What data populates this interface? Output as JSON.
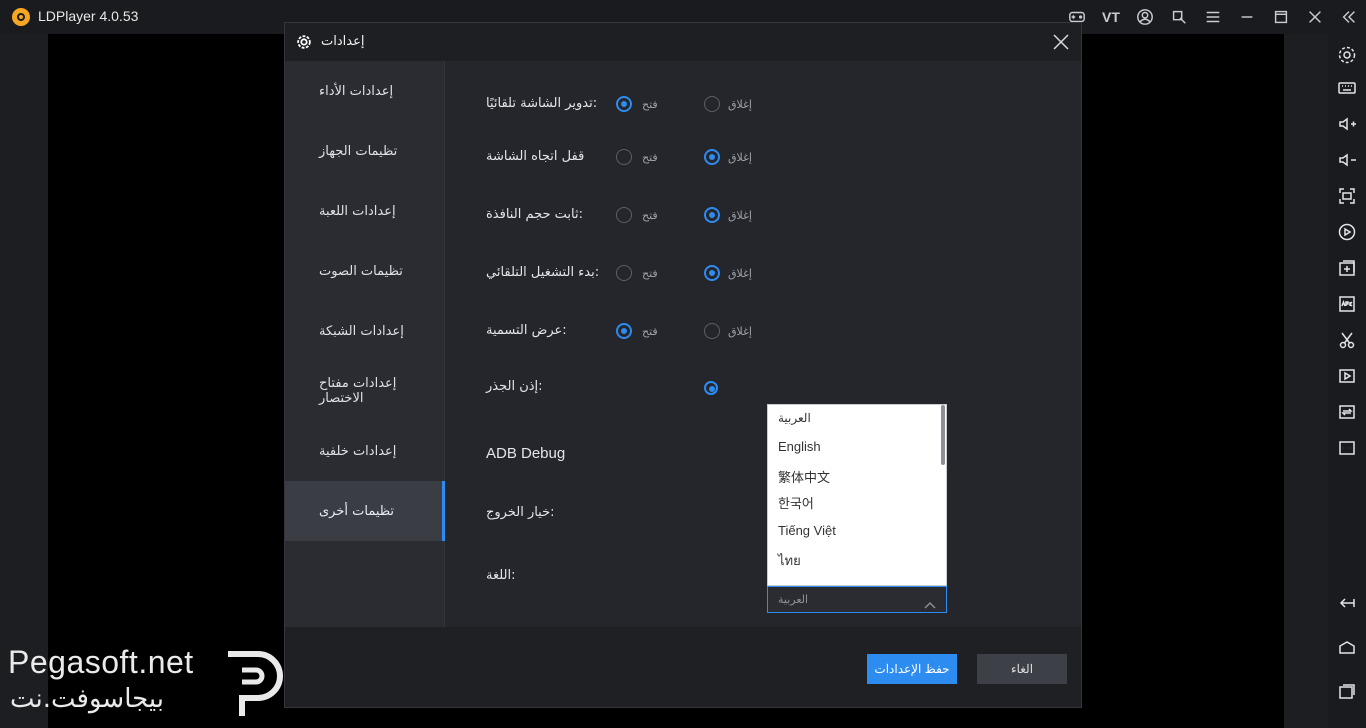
{
  "app": {
    "title": "LDPlayer 4.0.53",
    "titlebar_icons": [
      "gamepad-icon",
      "vt-icon",
      "account-icon",
      "expand-window-icon",
      "menu-icon",
      "minimize-icon",
      "maximize-icon",
      "close-icon",
      "collapse-sidebar-icon"
    ],
    "vt_label": "VT"
  },
  "dialog": {
    "title": "إعدادات",
    "nav": [
      {
        "label": "إعدادات الأداء"
      },
      {
        "label": "تظيمات الجهاز"
      },
      {
        "label": "إعدادات اللعبة"
      },
      {
        "label": "تظيمات الصوت"
      },
      {
        "label": "إعدادات الشبكة"
      },
      {
        "label": "إعدادات مفتاح الاختصار"
      },
      {
        "label": "إعدادات خلفية"
      },
      {
        "label": "تظيمات أخرى",
        "active": true
      }
    ],
    "rows": [
      {
        "label": "تدوير الشاشة تلقائيًا:",
        "on": "فتح",
        "off": "إغلاق",
        "selected": "on"
      },
      {
        "label": "قفل اتجاه الشاشة",
        "on": "فتح",
        "off": "إغلاق",
        "selected": "off"
      },
      {
        "label": "ثابت حجم النافذة:",
        "on": "فتح",
        "off": "إغلاق",
        "selected": "off"
      },
      {
        "label": "بدء التشغيل التلقائي:",
        "on": "فتح",
        "off": "إغلاق",
        "selected": "off"
      },
      {
        "label": "عرض التسمية:",
        "on": "فتح",
        "off": "إغلاق",
        "selected": "on"
      },
      {
        "label": "إذن الجذر:"
      },
      {
        "label": "ADB Debug"
      },
      {
        "label": "خيار الخروج:"
      },
      {
        "label": "اللغة:"
      }
    ],
    "language": {
      "selected": "العربية",
      "options": [
        "العربية",
        "English",
        "繁体中文",
        "한국어",
        "Tiếng Việt",
        "ไทย"
      ]
    },
    "save_label": "حفظ الإعدادات",
    "cancel_label": "الغاء"
  },
  "watermark": {
    "en": "Pegasoft.net",
    "ar": "بيجاسوفت.نت"
  }
}
